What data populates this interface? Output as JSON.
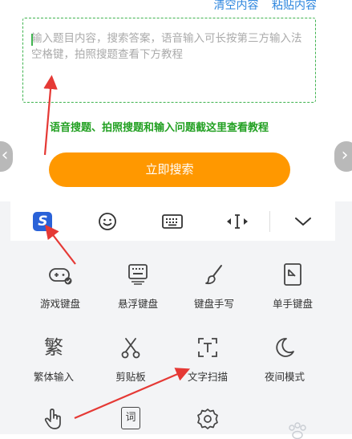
{
  "top_actions": {
    "clear": "清空内容",
    "paste": "粘贴内容"
  },
  "input": {
    "placeholder": "输入题目内容，搜索答案，语音输入可长按第三方输入法空格键，拍照搜题查看下方教程"
  },
  "help_link": "语音搜题、拍照搜题和输入问题截这里查看教程",
  "nav": {
    "prev": "‹",
    "next": "›"
  },
  "search_button": "立即搜索",
  "keyboard_toolbar": [
    {
      "icon": "sogou-logo-icon",
      "text": "S"
    },
    {
      "icon": "emoji-icon"
    },
    {
      "icon": "keyboard-icon"
    },
    {
      "icon": "cursor-move-icon"
    },
    {
      "icon": "chevron-down-icon"
    }
  ],
  "tools": [
    {
      "label": "游戏键盘",
      "icon": "gamepad-icon"
    },
    {
      "label": "悬浮键盘",
      "icon": "floating-keyboard-icon"
    },
    {
      "label": "键盘手写",
      "icon": "brush-icon"
    },
    {
      "label": "单手键盘",
      "icon": "one-hand-icon"
    },
    {
      "label": "繁体输入",
      "icon": "traditional-char-icon",
      "glyph": "繁"
    },
    {
      "label": "剪贴板",
      "icon": "scissors-icon"
    },
    {
      "label": "文字扫描",
      "icon": "text-scan-icon"
    },
    {
      "label": "夜间模式",
      "icon": "moon-icon"
    },
    {
      "label": "",
      "icon": "gesture-icon"
    },
    {
      "label": "",
      "icon": "dictionary-icon",
      "glyph": "词"
    },
    {
      "label": "",
      "icon": "settings-icon"
    }
  ],
  "colors": {
    "accent_orange": "#ff9800",
    "link_blue": "#2e86de",
    "green": "#22a022",
    "arrow_red": "#e53935"
  }
}
